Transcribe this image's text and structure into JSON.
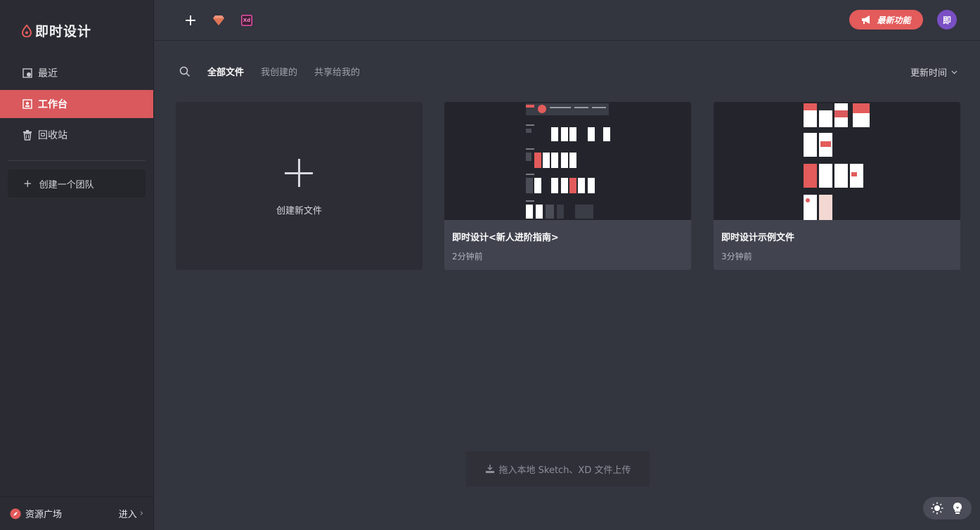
{
  "app": {
    "name": "即时设计"
  },
  "sidebar": {
    "items": [
      {
        "label": "最近",
        "icon": "clock-icon"
      },
      {
        "label": "工作台",
        "icon": "workspace-icon",
        "active": true
      },
      {
        "label": "回收站",
        "icon": "trash-icon"
      }
    ],
    "team_button": "创建一个团队",
    "bottom": {
      "left_label": "资源广场",
      "right_label": "进入"
    }
  },
  "topbar": {
    "tools": [
      "plus-icon",
      "sketch-icon",
      "xd-icon"
    ],
    "xd_label": "Xd",
    "new_feature_label": "最新功能",
    "avatar_initial": "即"
  },
  "filter": {
    "tabs": [
      "全部文件",
      "我创建的",
      "共享给我的"
    ],
    "active_tab": 0,
    "sort_label": "更新时间"
  },
  "cards": {
    "new_label": "创建新文件",
    "files": [
      {
        "title": "即时设计<新人进阶指南>",
        "time": "2分钟前"
      },
      {
        "title": "即时设计示例文件",
        "time": "3分钟前"
      }
    ]
  },
  "upload": {
    "label": "拖入本地 Sketch、XD 文件上传"
  },
  "colors": {
    "accent": "#d9595d",
    "feature": "#e35b5b",
    "avatar": "#7a4fc4",
    "sidebar": "#2b2c33",
    "main": "#33353f"
  }
}
